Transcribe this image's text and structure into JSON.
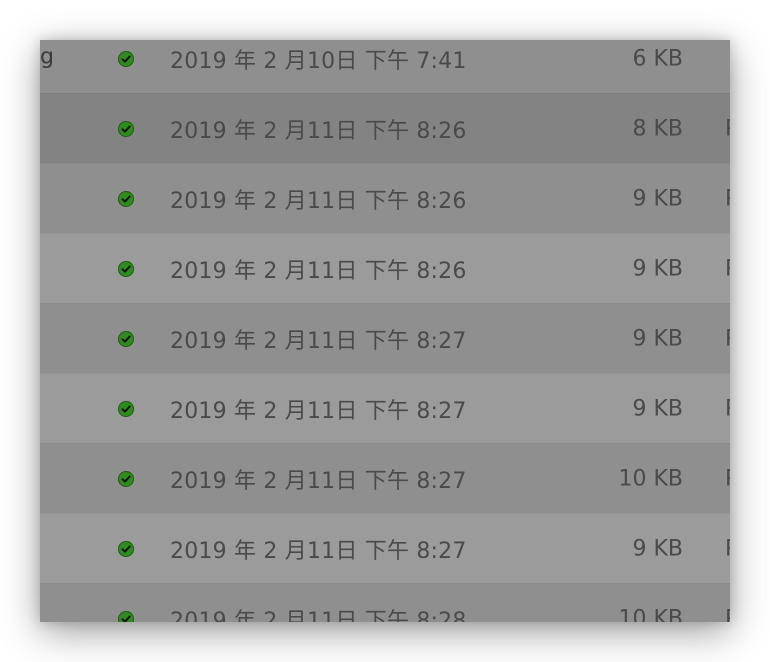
{
  "file_list": {
    "rows": [
      {
        "name_fragment": "g",
        "status": "synced",
        "modified": "2019 年 2 月10日 下午 7:41",
        "size": "6 KB",
        "kind_fragment": "",
        "selected": false
      },
      {
        "name_fragment": "",
        "status": "synced",
        "modified": "2019 年 2 月11日 下午 8:26",
        "size": "8 KB",
        "kind_fragment": "P",
        "selected": true
      },
      {
        "name_fragment": "",
        "status": "synced",
        "modified": "2019 年 2 月11日 下午 8:26",
        "size": "9 KB",
        "kind_fragment": "P",
        "selected": false
      },
      {
        "name_fragment": "",
        "status": "synced",
        "modified": "2019 年 2 月11日 下午 8:26",
        "size": "9 KB",
        "kind_fragment": "P",
        "selected": false
      },
      {
        "name_fragment": "",
        "status": "synced",
        "modified": "2019 年 2 月11日 下午 8:27",
        "size": "9 KB",
        "kind_fragment": "P",
        "selected": false
      },
      {
        "name_fragment": "",
        "status": "synced",
        "modified": "2019 年 2 月11日 下午 8:27",
        "size": "9 KB",
        "kind_fragment": "P",
        "selected": false
      },
      {
        "name_fragment": "",
        "status": "synced",
        "modified": "2019 年 2 月11日 下午 8:27",
        "size": "10 KB",
        "kind_fragment": "P",
        "selected": false
      },
      {
        "name_fragment": "",
        "status": "synced",
        "modified": "2019 年 2 月11日 下午 8:27",
        "size": "9 KB",
        "kind_fragment": "P",
        "selected": false
      },
      {
        "name_fragment": "",
        "status": "synced",
        "modified": "2019 年 2 月11日 下午 8:28",
        "size": "10 KB",
        "kind_fragment": "P",
        "selected": false
      }
    ]
  },
  "colors": {
    "status_synced": "#2f8a1f",
    "row_selected": "#838383",
    "row_alt_a": "#8f8f8f",
    "row_alt_b": "#9b9b9b",
    "text": "#4a4a4a"
  },
  "icons": {
    "status": "checkmark-circle-icon"
  }
}
